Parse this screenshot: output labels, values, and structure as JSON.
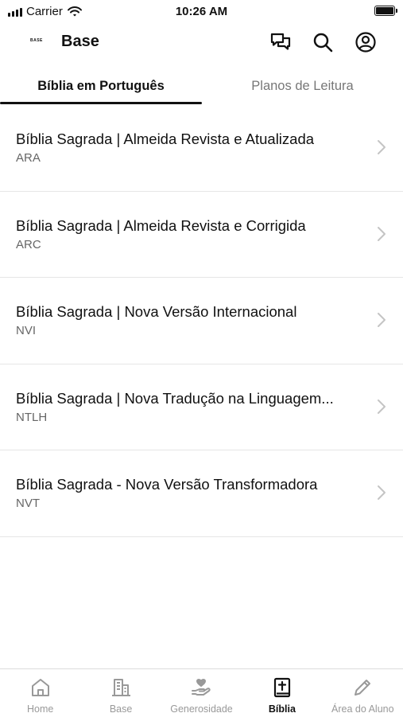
{
  "status": {
    "carrier": "Carrier",
    "time": "10:26 AM"
  },
  "header": {
    "logo": "BASE",
    "title": "Base"
  },
  "tabs": [
    {
      "label": "Bíblia em Português"
    },
    {
      "label": "Planos de Leitura"
    }
  ],
  "bibles": [
    {
      "title": "Bíblia Sagrada | Almeida Revista e Atualizada",
      "abbr": "ARA"
    },
    {
      "title": "Bíblia Sagrada | Almeida Revista e Corrigida",
      "abbr": "ARC"
    },
    {
      "title": "Bíblia Sagrada | Nova Versão Internacional",
      "abbr": "NVI"
    },
    {
      "title": "Bíblia Sagrada | Nova Tradução na Linguagem...",
      "abbr": "NTLH"
    },
    {
      "title": "Bíblia Sagrada - Nova Versão Transformadora",
      "abbr": "NVT"
    }
  ],
  "bottom_nav": [
    {
      "label": "Home",
      "icon": "home-icon"
    },
    {
      "label": "Base",
      "icon": "building-icon"
    },
    {
      "label": "Generosidade",
      "icon": "hand-heart-icon"
    },
    {
      "label": "Bíblia",
      "icon": "bible-icon",
      "active": true
    },
    {
      "label": "Área do Aluno",
      "icon": "pencil-icon"
    }
  ]
}
